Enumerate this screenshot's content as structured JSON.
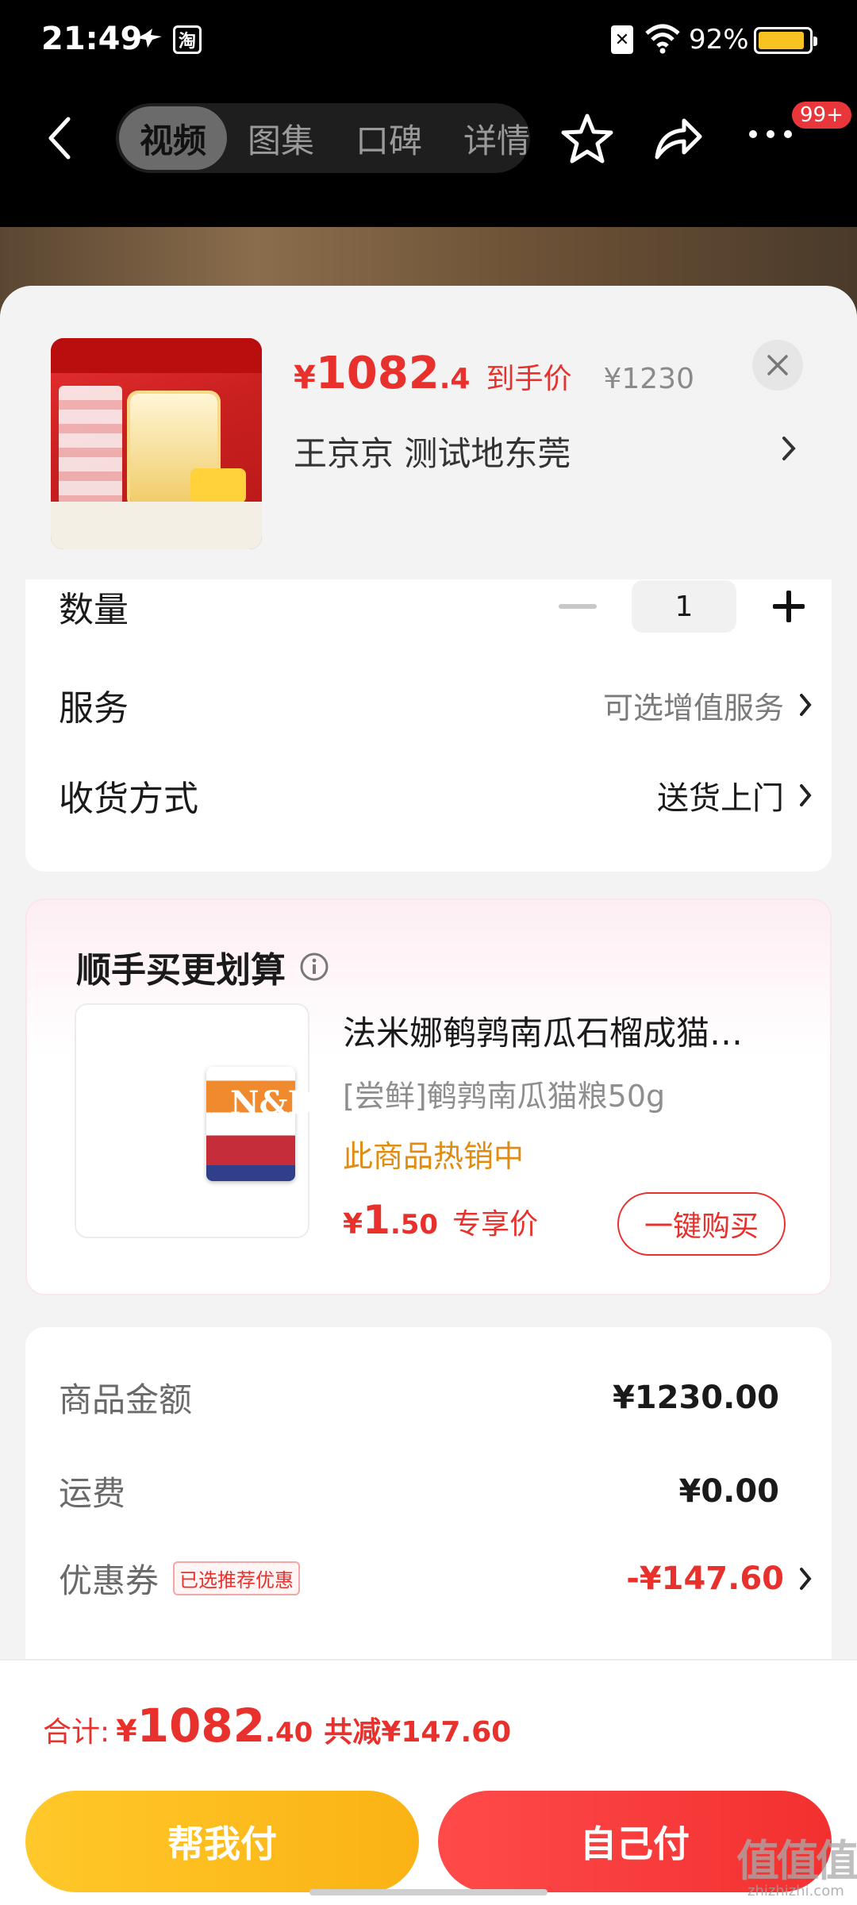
{
  "status_bar": {
    "time": "21:49",
    "battery_pct": "92%",
    "battery_level": 0.92,
    "icons": [
      "bird-icon",
      "taobao-icon",
      "sim-icon",
      "wifi-icon",
      "battery-icon"
    ]
  },
  "nav": {
    "tabs": [
      {
        "label": "视频",
        "active": true
      },
      {
        "label": "图集",
        "active": false
      },
      {
        "label": "口碑",
        "active": false
      },
      {
        "label": "详情",
        "active": false
      }
    ],
    "badge": "99+"
  },
  "sheet": {
    "product": {
      "price_currency": "¥",
      "price_main": "1082",
      "price_decimal": ".4",
      "price_tag": "到手价",
      "original_price": "¥1230",
      "address": "王京京  测试地东莞"
    },
    "options": {
      "quantity_label": "数量",
      "quantity_value": "1",
      "service_label": "服务",
      "service_value": "可选增值服务",
      "delivery_label": "收货方式",
      "delivery_value": "送货上门"
    },
    "upsell": {
      "title": "顺手买更划算",
      "name": "法米娜鹌鹑南瓜石榴成猫…",
      "subtitle": "[尝鲜]鹌鹑南瓜猫粮50g",
      "hot": "此商品热销中",
      "price_currency": "¥",
      "price_main": "1",
      "price_decimal": ".50",
      "price_tag": "专享价",
      "buy_label": "一键购买"
    },
    "summary": {
      "goods_label": "商品金额",
      "goods_value": "¥1230.00",
      "shipping_label": "运费",
      "shipping_value": "¥0.00",
      "coupon_label": "优惠券",
      "coupon_tag": "已选推荐优惠",
      "coupon_value": "-¥147.60"
    }
  },
  "bottom": {
    "total_label": "合计:",
    "total_currency": "¥",
    "total_main": "1082",
    "total_decimal": ".40",
    "total_saved": "共减¥147.60",
    "help_pay": "帮我付",
    "self_pay": "自己付"
  },
  "watermark": {
    "main": "值值值",
    "sub": "zhizhizhi.com"
  },
  "colors": {
    "accent_red": "#e8312c",
    "help_yellow": "#fbb214",
    "hot_orange": "#e08b12"
  }
}
